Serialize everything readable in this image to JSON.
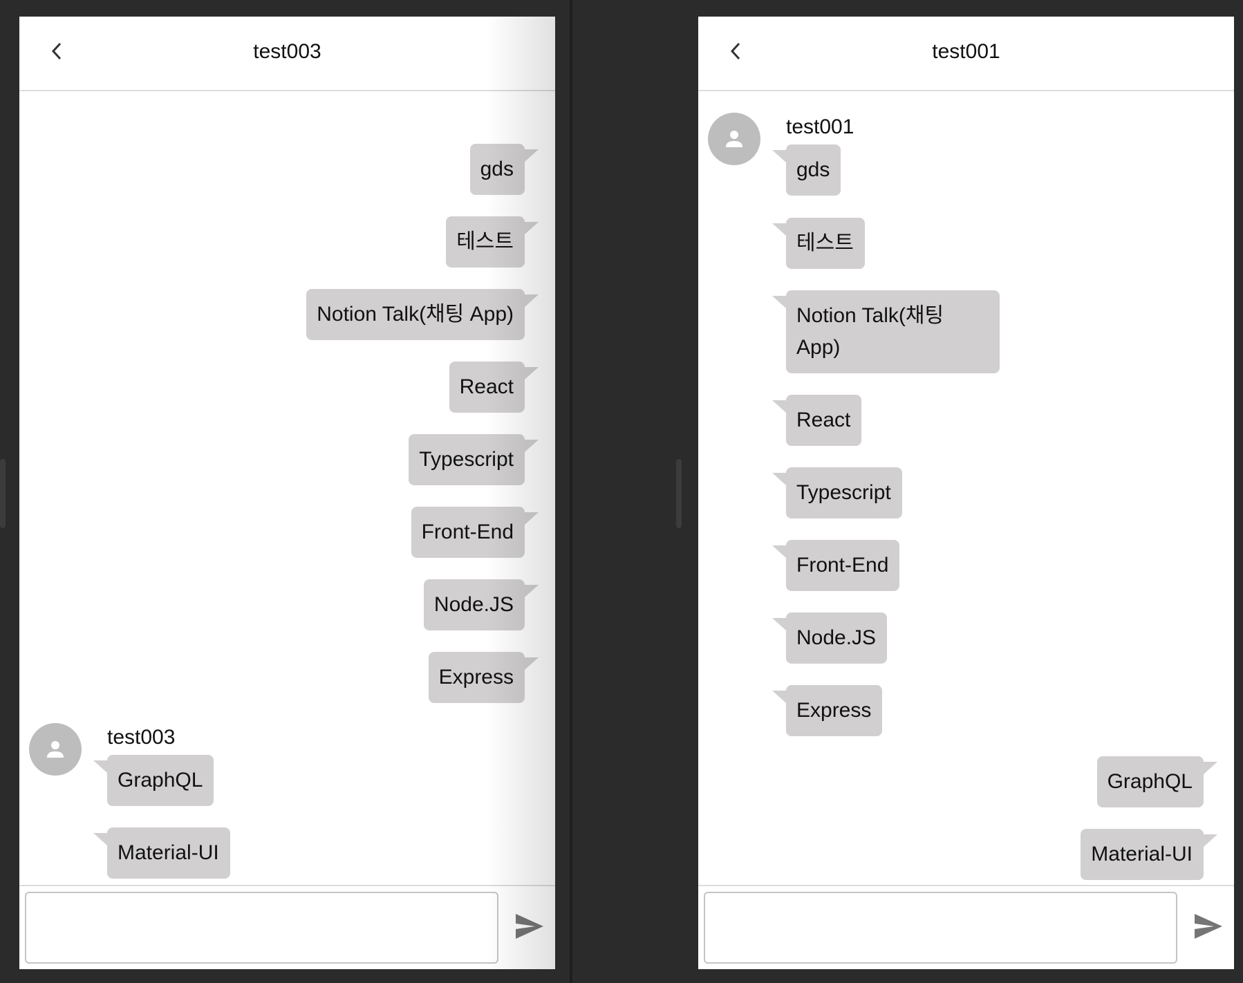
{
  "left_window": {
    "title": "test003",
    "sent_messages": [
      "gds",
      "테스트",
      "Notion Talk(채팅 App)",
      "React",
      "Typescript",
      "Front-End",
      "Node.JS",
      "Express"
    ],
    "other_sender": "test003",
    "received_messages": [
      "GraphQL",
      "Material-UI"
    ],
    "input_value": ""
  },
  "right_window": {
    "title": "test001",
    "other_sender": "test001",
    "received_messages": [
      "gds",
      "테스트",
      "Notion Talk(채팅 App)",
      "React",
      "Typescript",
      "Front-End",
      "Node.JS",
      "Express"
    ],
    "sent_messages": [
      "GraphQL",
      "Material-UI"
    ],
    "input_value": ""
  },
  "icons": {
    "back": "chevron-left-icon",
    "avatar": "person-icon",
    "send": "send-icon"
  },
  "colors": {
    "bubble": "#d1cfcf",
    "avatar": "#bdbdbd",
    "background": "#2b2b2b",
    "icon": "#757575"
  }
}
